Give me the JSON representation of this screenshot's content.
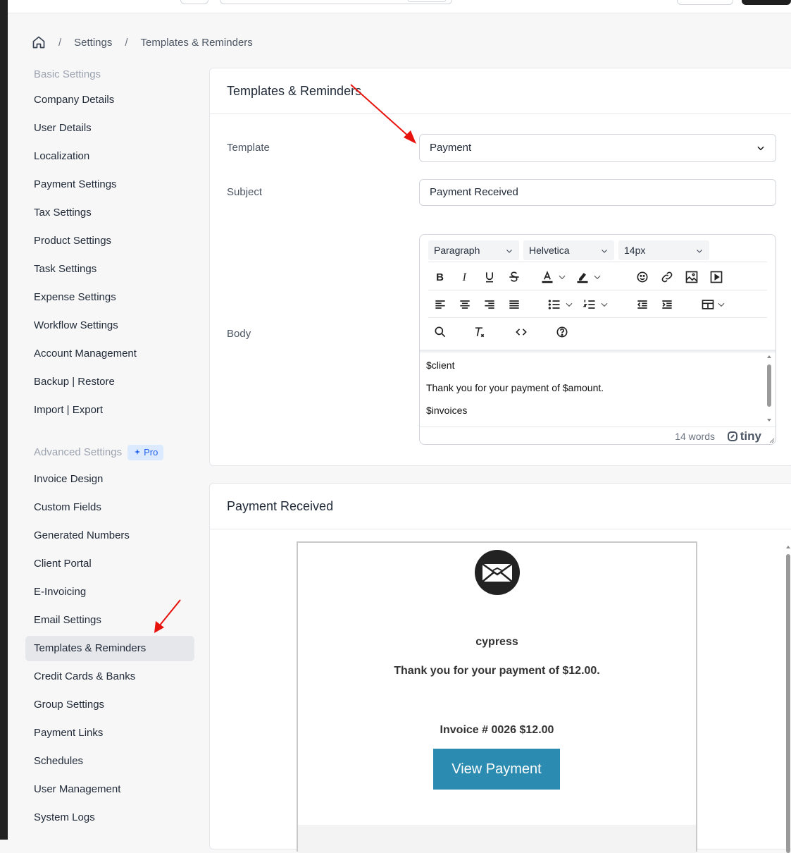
{
  "breadcrumb": {
    "items": [
      "Settings",
      "Templates & Reminders"
    ],
    "separator": "/"
  },
  "sidebar": {
    "basic_heading": "Basic Settings",
    "basic_items": [
      "Company Details",
      "User Details",
      "Localization",
      "Payment Settings",
      "Tax Settings",
      "Product Settings",
      "Task Settings",
      "Expense Settings",
      "Workflow Settings",
      "Account Management",
      "Backup | Restore",
      "Import | Export"
    ],
    "advanced_heading": "Advanced Settings",
    "pro_badge": "Pro",
    "advanced_items": [
      "Invoice Design",
      "Custom Fields",
      "Generated Numbers",
      "Client Portal",
      "E-Invoicing",
      "Email Settings",
      "Templates & Reminders",
      "Credit Cards & Banks",
      "Group Settings",
      "Payment Links",
      "Schedules",
      "User Management",
      "System Logs"
    ],
    "active_item": "Templates & Reminders"
  },
  "form": {
    "title": "Templates & Reminders",
    "template_label": "Template",
    "template_value": "Payment",
    "subject_label": "Subject",
    "subject_value": "Payment Received",
    "body_label": "Body"
  },
  "editor": {
    "block_format": "Paragraph",
    "font_family": "Helvetica",
    "font_size": "14px",
    "body_lines": [
      "$client",
      "Thank you for your payment of $amount.",
      "$invoices"
    ],
    "word_count": "14 words",
    "brand": "tiny"
  },
  "preview": {
    "title": "Payment Received",
    "company": "cypress",
    "thanks": "Thank you for your payment of $12.00.",
    "invoice_line": "Invoice # 0026 $12.00",
    "button_label": "View Payment",
    "button_color": "#2b8bb0"
  },
  "annotation_color": "#e8120c"
}
